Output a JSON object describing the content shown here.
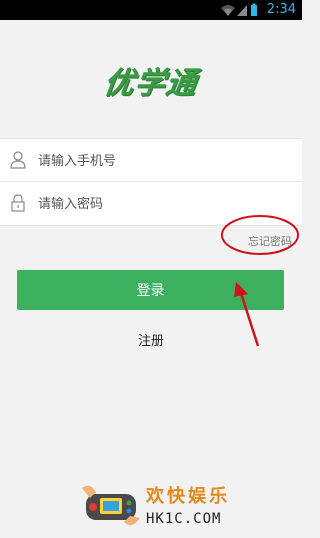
{
  "status_bar": {
    "time": "2:34"
  },
  "app": {
    "logo_text": "优学通"
  },
  "login_form": {
    "phone_placeholder": "请输入手机号",
    "password_placeholder": "请输入密码",
    "forgot_password": "忘记密码",
    "login_button": "登录",
    "register_link": "注册"
  },
  "watermark": {
    "name": "欢快娱乐",
    "url": "HK1C.COM"
  },
  "colors": {
    "primary": "#3cb05e",
    "logo": "#3a9b45",
    "annotation": "#d0121b",
    "status_accent": "#33b5e5"
  },
  "icons": [
    "wifi-icon",
    "signal-icon",
    "battery-icon",
    "user-icon",
    "lock-icon",
    "game-controller-icon"
  ]
}
